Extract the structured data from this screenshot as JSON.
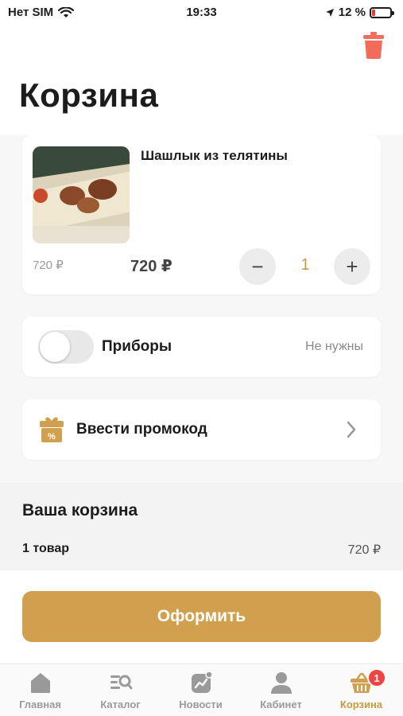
{
  "status": {
    "carrier": "Нет SIM",
    "time": "19:33",
    "battery": "12 %"
  },
  "header": {
    "title": "Корзина"
  },
  "cart_item": {
    "name": "Шашлык из телятины",
    "old_price": "720 ₽",
    "price": "720 ₽",
    "minus": "−",
    "quantity": "1",
    "plus": "+"
  },
  "cutlery": {
    "label": "Приборы",
    "value": "Не нужны",
    "enabled": false
  },
  "promo": {
    "label": "Ввести промокод"
  },
  "summary": {
    "title": "Ваша корзина",
    "items_count": "1 товар",
    "total": "720 ₽"
  },
  "checkout": {
    "label": "Оформить"
  },
  "tabs": [
    {
      "label": "Главная",
      "icon": "home-icon"
    },
    {
      "label": "Каталог",
      "icon": "catalog-search-icon"
    },
    {
      "label": "Новости",
      "icon": "news-icon"
    },
    {
      "label": "Кабинет",
      "icon": "user-icon"
    },
    {
      "label": "Корзина",
      "icon": "basket-icon",
      "badge": "1",
      "active": true
    }
  ],
  "colors": {
    "accent": "#d1a04f",
    "quantity": "#c99a3d",
    "trash": "#f26b5b",
    "badge": "#ef4444"
  }
}
